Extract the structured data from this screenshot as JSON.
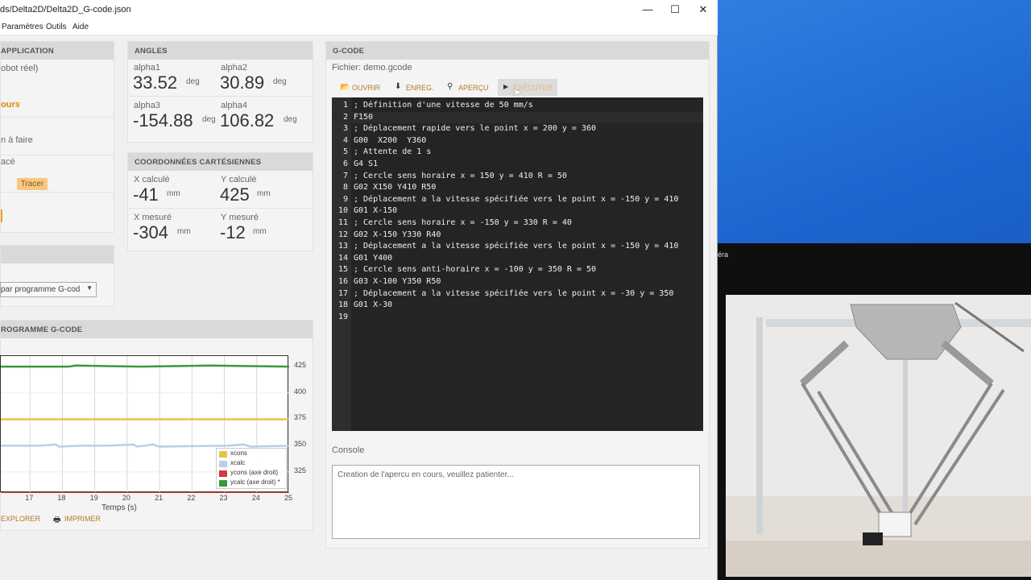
{
  "window": {
    "title": "ds/Delta2D/Delta2D_G-code.json",
    "controls": {
      "minimize": "—",
      "maximize": "☐",
      "close": "✕"
    }
  },
  "menu": [
    "Paramètres",
    "Outils",
    "Aide"
  ],
  "application": {
    "header": "APPLICATION",
    "lines": [
      "obot réel)",
      "ours",
      "n à faire",
      "acé"
    ],
    "tracer_label": "Tracer"
  },
  "mode_panel": {
    "select_value": "par programme G-cod"
  },
  "angles": {
    "header": "ANGLES",
    "items": [
      {
        "label": "alpha1",
        "value": "33.52",
        "unit": "deg"
      },
      {
        "label": "alpha2",
        "value": "30.89",
        "unit": "deg"
      },
      {
        "label": "alpha3",
        "value": "-154.88",
        "unit": "deg"
      },
      {
        "label": "alpha4",
        "value": "106.82",
        "unit": "deg"
      }
    ]
  },
  "coords": {
    "header": "COORDONNÉES CARTÉSIENNES",
    "items": [
      {
        "label": "X calculé",
        "value": "-41",
        "unit": "mm"
      },
      {
        "label": "Y calculé",
        "value": "425",
        "unit": "mm"
      },
      {
        "label": "X mesuré",
        "value": "-304",
        "unit": "mm"
      },
      {
        "label": "Y mesuré",
        "value": "-12",
        "unit": "mm"
      }
    ]
  },
  "program_chart": {
    "header": "ROGRAMME G-CODE",
    "xlabel": "Temps (s)",
    "explore_label": "EXPLORER",
    "print_label": "IMPRIMER"
  },
  "chart_data": {
    "type": "line",
    "xlabel": "Temps (s)",
    "x_ticks": [
      "17",
      "18",
      "19",
      "20",
      "21",
      "22",
      "23",
      "24",
      "25"
    ],
    "y_ticks": [
      "425",
      "400",
      "375",
      "350",
      "325"
    ],
    "xlim": [
      16.1,
      25
    ],
    "ylim": [
      305,
      435
    ],
    "legend": "bottom-right",
    "series": [
      {
        "name": "xcons",
        "color": "#e6c34a",
        "values": [
          [
            16.1,
            375
          ],
          [
            25,
            375
          ]
        ]
      },
      {
        "name": "xcalc",
        "color": "#b9cfe8",
        "values": [
          [
            16.1,
            350
          ],
          [
            17.3,
            350
          ],
          [
            17.8,
            351
          ],
          [
            17.9,
            349
          ],
          [
            18.6,
            350
          ],
          [
            19.4,
            350
          ],
          [
            20.2,
            351
          ],
          [
            20.3,
            349
          ],
          [
            20.8,
            351
          ],
          [
            21.0,
            349
          ],
          [
            23.1,
            350
          ],
          [
            23.6,
            351
          ],
          [
            23.8,
            349
          ],
          [
            25,
            350
          ]
        ]
      },
      {
        "name": "ycons (axe droit)",
        "color": "#d33a3a",
        "values": [
          [
            16.1,
            305
          ],
          [
            25,
            305
          ]
        ]
      },
      {
        "name": "ycalc (axe droit) *",
        "color": "#3a9a3a",
        "values": [
          [
            16.1,
            425
          ],
          [
            18.2,
            425
          ],
          [
            18.4,
            426
          ],
          [
            20.4,
            425
          ],
          [
            22.5,
            426
          ],
          [
            25,
            425
          ]
        ]
      }
    ]
  },
  "gcode": {
    "header": "G-CODE",
    "file_label": "Fichier: demo.gcode",
    "buttons": {
      "open": "OUVRIR",
      "save": "ENREG.",
      "preview": "APERÇU",
      "run": "EXÉCUTER"
    },
    "lines": [
      "; Définition d'une vitesse de 50 mm/s",
      "F150",
      "; Déplacement rapide vers le point x = 200 y = 360",
      "G00  X200  Y360",
      "; Attente de 1 s",
      "G4 S1",
      "; Cercle sens horaire x = 150 y = 410 R = 50",
      "G02 X150 Y410 R50",
      "; Déplacement a la vitesse spécifiée vers le point x = -150 y = 410",
      "G01 X-150",
      "; Cercle sens horaire x = -150 y = 330 R = 40",
      "G02 X-150 Y330 R40",
      "; Déplacement a la vitesse spécifiée vers le point x = -150 y = 410",
      "G01 Y400",
      "; Cercle sens anti-horaire x = -100 y = 350 R = 50",
      "G03 X-100 Y350 R50",
      "; Déplacement a la vitesse spécifiée vers le point x = -30 y = 350",
      "G01 X-30",
      ""
    ]
  },
  "console": {
    "label": "Console",
    "text": "Creation de l'apercu en cours, veuillez patienter..."
  },
  "desktop": {
    "camera_label": "éra"
  }
}
